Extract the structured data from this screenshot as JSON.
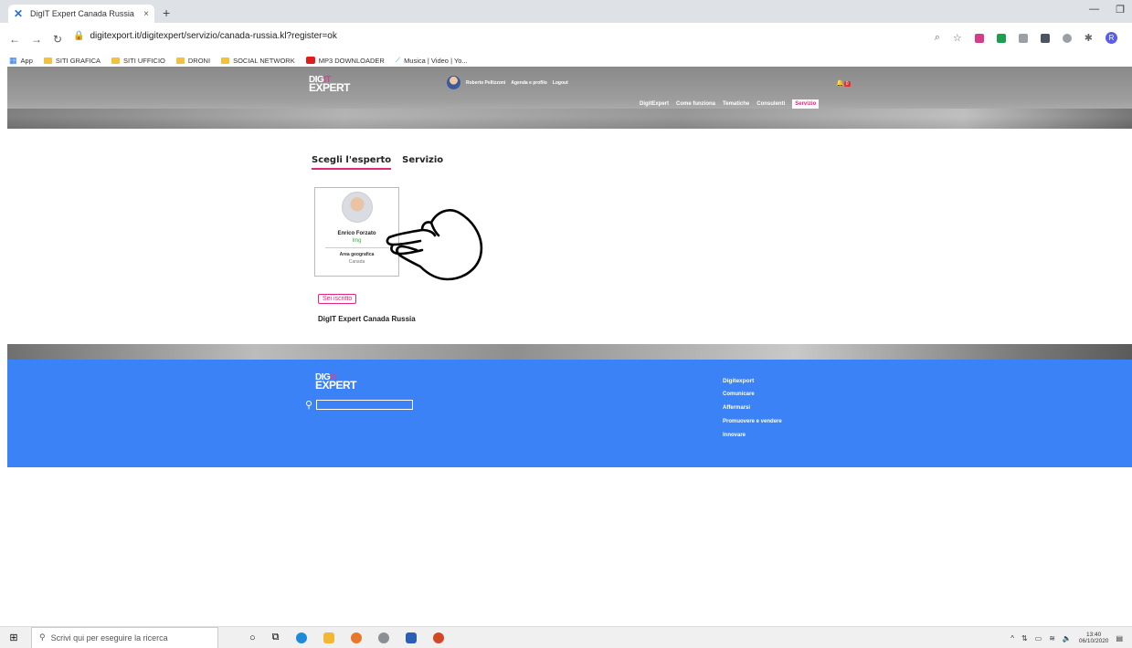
{
  "browser": {
    "tab_title": "DigIT Expert Canada Russia",
    "tab_close": "×",
    "new_tab": "+",
    "url": "digitexport.it/digitexpert/servizio/canada-russia.kl?register=ok",
    "bookmarks": [
      "App",
      "SITI GRAFICA",
      "SITI UFFICIO",
      "DRONI",
      "SOCIAL NETWORK",
      "MP3 DOWNLOADER",
      "Musica | Video | Yo..."
    ],
    "profile_initial": "R"
  },
  "header": {
    "logo_dig": "DIG",
    "logo_it": "IT",
    "logo_expert": "EXPERT",
    "user_name": "Roberto Pellizzoni",
    "agenda_link": "Agenda e profilo",
    "logout_link": "Logout",
    "notification_count": "0",
    "nav": [
      "DigitExpert",
      "Come funziona",
      "Tematiche",
      "Consulenti"
    ],
    "nav_active": "Servizio"
  },
  "main": {
    "tabs": [
      "Scegli l'esperto",
      "Servizio"
    ],
    "expert": {
      "name": "Enrico Forzato",
      "role": "Img",
      "area_label": "Area geografica",
      "area_value": "Canada"
    },
    "subscribed_badge": "Sei iscritto",
    "service_name": "DigIT Expert Canada Russia"
  },
  "footer": {
    "logo_dig": "DIG",
    "logo_it": "IT",
    "logo_expert": "EXPERT",
    "search_placeholder": "",
    "links_title": "Digitexport",
    "links": [
      "Comunicare",
      "Affermarsi",
      "Promuovere e vendere",
      "Innovare"
    ]
  },
  "taskbar": {
    "search_placeholder": "Scrivi qui per eseguire la ricerca",
    "time": "13:40",
    "date": "06/10/2020"
  },
  "colors": {
    "accent_pink": "#e0267e",
    "footer_blue": "#3b82f6",
    "role_green": "#3cb043"
  }
}
